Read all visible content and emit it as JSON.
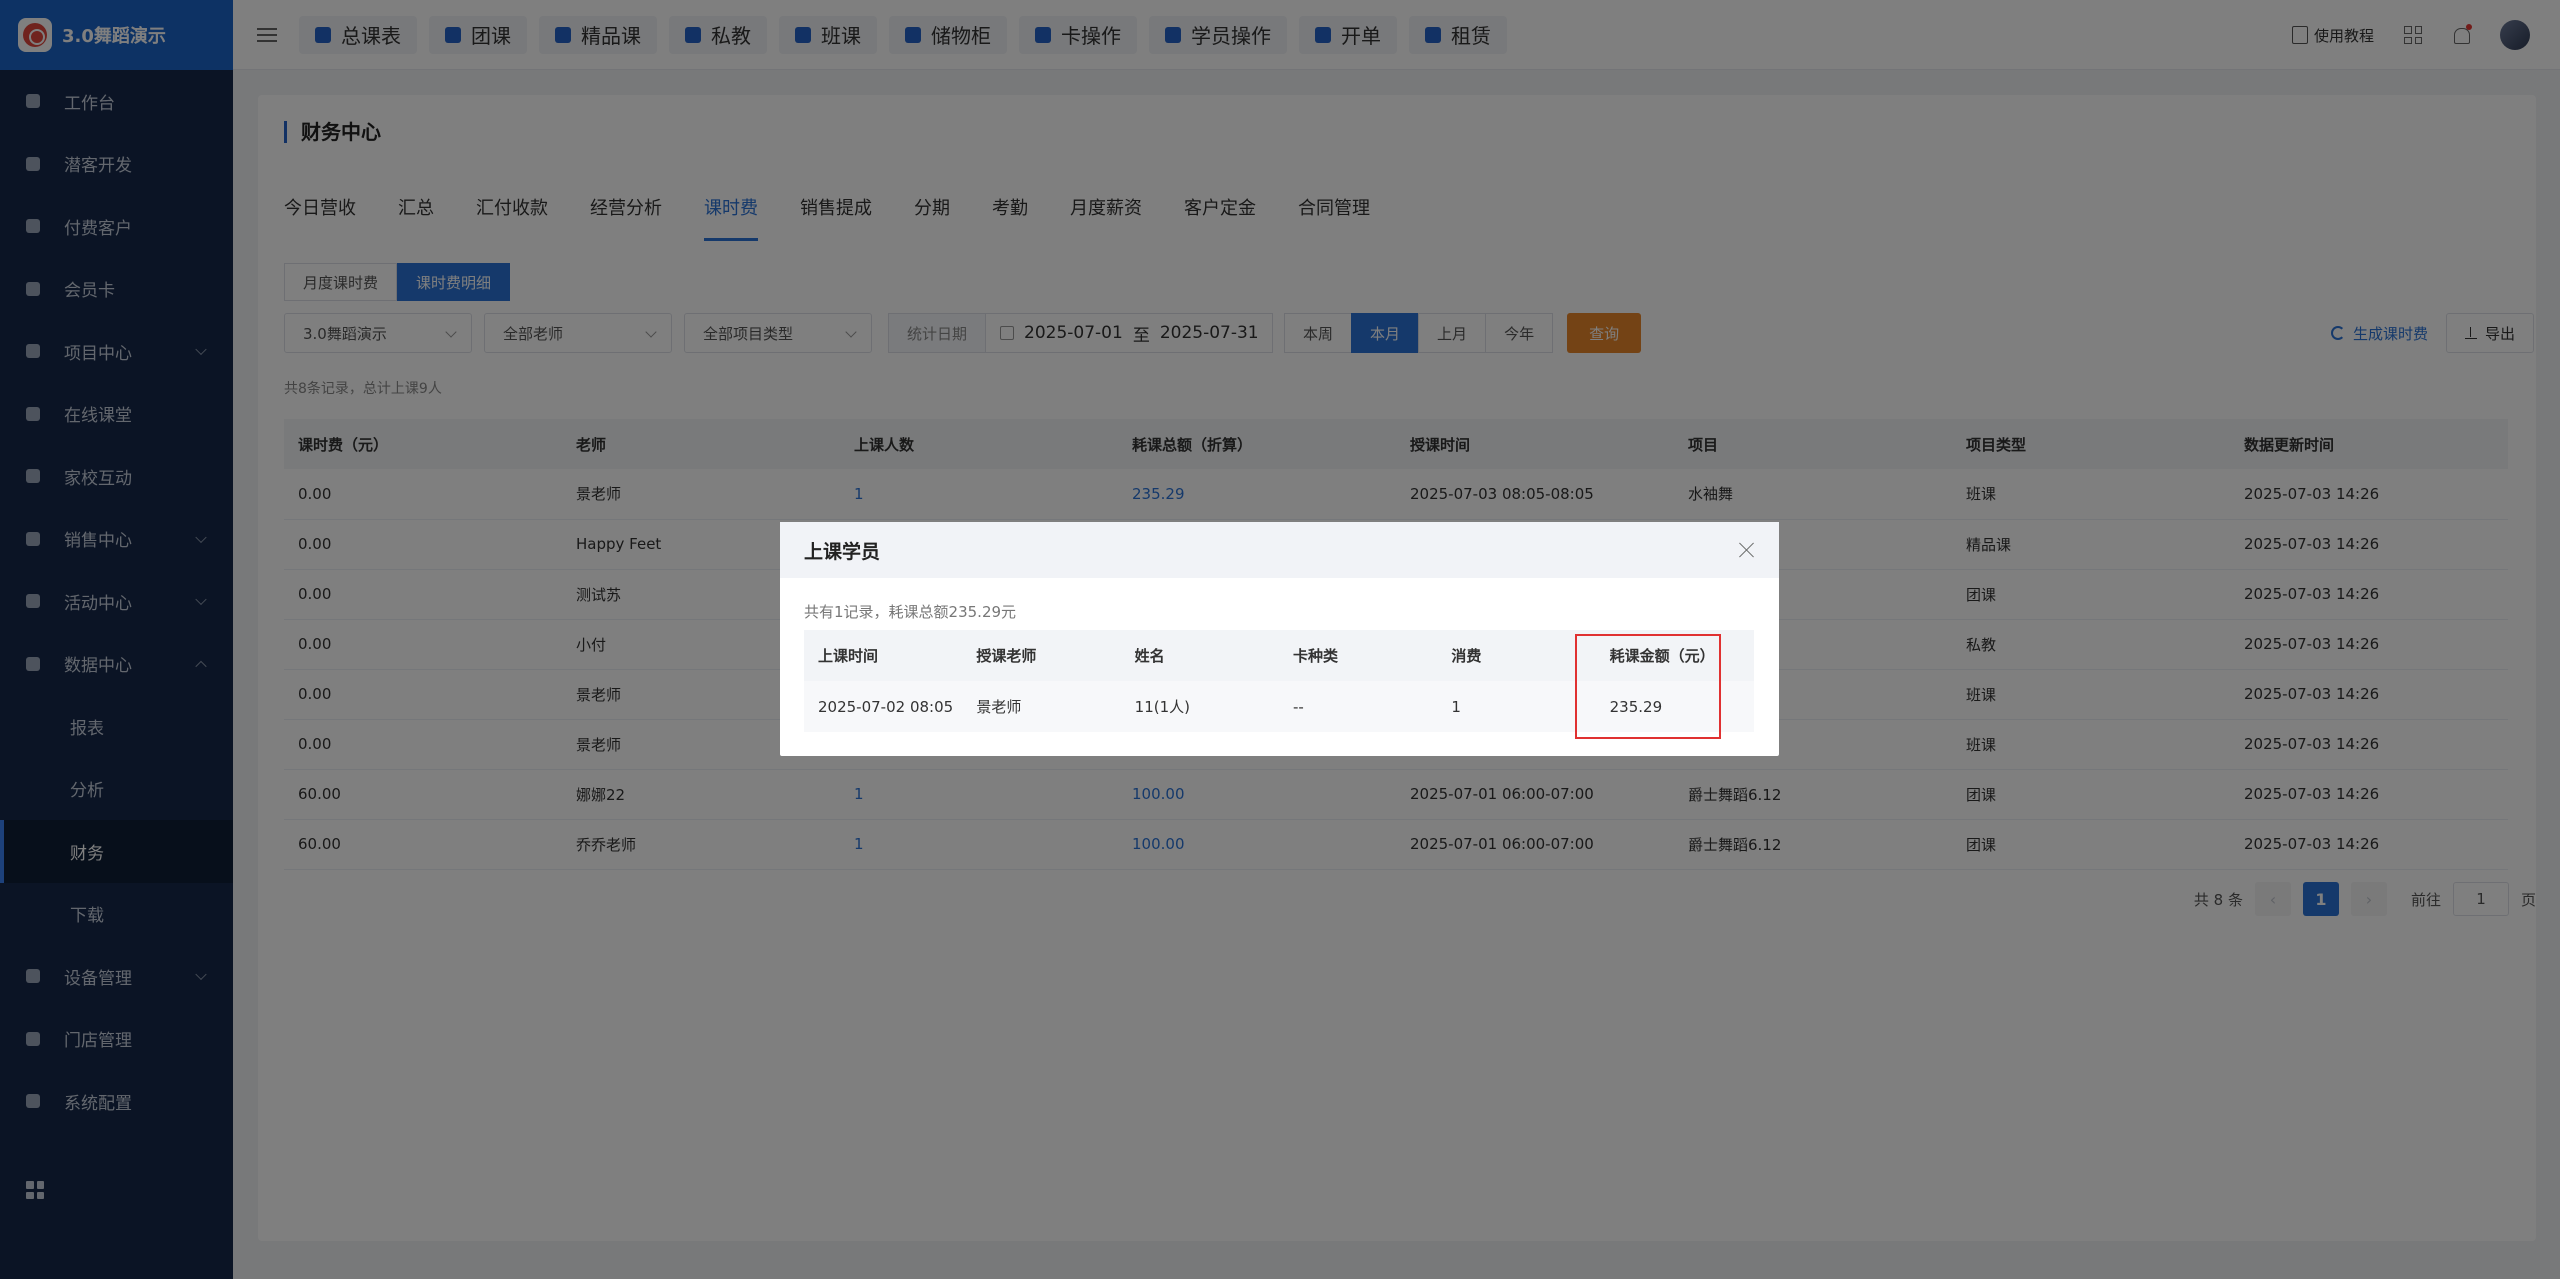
{
  "brand": {
    "name": "3.0舞蹈演示"
  },
  "sidebar": {
    "items": [
      {
        "label": "工作台",
        "icon": "image-icon"
      },
      {
        "label": "潜客开发",
        "icon": "id-card-icon"
      },
      {
        "label": "付费客户",
        "icon": "users-icon"
      },
      {
        "label": "会员卡",
        "icon": "card-icon"
      },
      {
        "label": "项目中心",
        "icon": "folder-icon",
        "expandable": true
      },
      {
        "label": "在线课堂",
        "icon": "bag-icon"
      },
      {
        "label": "家校互动",
        "icon": "contact-icon"
      },
      {
        "label": "销售中心",
        "icon": "tag-icon",
        "expandable": true
      },
      {
        "label": "活动中心",
        "icon": "gift-icon",
        "expandable": true
      },
      {
        "label": "数据中心",
        "icon": "pie-icon",
        "expanded": true
      }
    ],
    "sub_items": [
      {
        "label": "报表"
      },
      {
        "label": "分析"
      },
      {
        "label": "财务",
        "active": true
      },
      {
        "label": "下载"
      }
    ],
    "items_after": [
      {
        "label": "设备管理",
        "icon": "device-icon",
        "expandable": true
      },
      {
        "label": "门店管理",
        "icon": "store-icon"
      },
      {
        "label": "系统配置",
        "icon": "monitor-icon"
      }
    ]
  },
  "topbar": {
    "tabs": [
      {
        "label": "总课表"
      },
      {
        "label": "团课"
      },
      {
        "label": "精品课"
      },
      {
        "label": "私教"
      },
      {
        "label": "班课"
      },
      {
        "label": "储物柜"
      },
      {
        "label": "卡操作"
      },
      {
        "label": "学员操作"
      },
      {
        "label": "开单"
      },
      {
        "label": "租赁"
      }
    ],
    "help_label": "使用教程"
  },
  "page": {
    "title": "财务中心",
    "tabs": [
      {
        "label": "今日营收"
      },
      {
        "label": "汇总"
      },
      {
        "label": "汇付收款"
      },
      {
        "label": "经营分析"
      },
      {
        "label": "课时费",
        "active": true
      },
      {
        "label": "销售提成"
      },
      {
        "label": "分期"
      },
      {
        "label": "考勤"
      },
      {
        "label": "月度薪资"
      },
      {
        "label": "客户定金"
      },
      {
        "label": "合同管理"
      }
    ],
    "segments": [
      {
        "label": "月度课时费"
      },
      {
        "label": "课时费明细",
        "active": true
      }
    ],
    "filters": {
      "store": "3.0舞蹈演示",
      "teacher": "全部老师",
      "project_type": "全部项目类型",
      "date_label": "统计日期",
      "date_start": "2025-07-01",
      "date_sep": "至",
      "date_end": "2025-07-31",
      "quick": [
        {
          "label": "本周"
        },
        {
          "label": "本月",
          "active": true
        },
        {
          "label": "上月"
        },
        {
          "label": "今年"
        }
      ],
      "query_label": "查询",
      "generate_label": "生成课时费",
      "export_label": "导出"
    },
    "summary": "共8条记录，总计上课9人",
    "table": {
      "headers": [
        "课时费（元）",
        "老师",
        "上课人数",
        "耗课总额（折算）",
        "授课时间",
        "项目",
        "项目类型",
        "数据更新时间"
      ],
      "rows": [
        [
          "0.00",
          "景老师",
          "1",
          "235.29",
          "2025-07-03 08:05-08:05",
          "水袖舞",
          "班课",
          "2025-07-03 14:26"
        ],
        [
          "0.00",
          "Happy Feet",
          "",
          "",
          "",
          "",
          "精品课",
          "2025-07-03 14:26"
        ],
        [
          "0.00",
          "测试苏",
          "",
          "",
          "",
          "",
          "团课",
          "2025-07-03 14:26"
        ],
        [
          "0.00",
          "小付",
          "",
          "",
          "",
          "",
          "私教",
          "2025-07-03 14:26"
        ],
        [
          "0.00",
          "景老师",
          "",
          "",
          "",
          "",
          "班课",
          "2025-07-03 14:26"
        ],
        [
          "0.00",
          "景老师",
          "",
          "",
          "",
          "",
          "班课",
          "2025-07-03 14:26"
        ],
        [
          "60.00",
          "娜娜22",
          "1",
          "100.00",
          "2025-07-01 06:00-07:00",
          "爵士舞蹈6.12",
          "团课",
          "2025-07-03 14:26"
        ],
        [
          "60.00",
          "乔乔老师",
          "1",
          "100.00",
          "2025-07-01 06:00-07:00",
          "爵士舞蹈6.12",
          "团课",
          "2025-07-03 14:26"
        ]
      ]
    },
    "pager": {
      "total": "共 8 条",
      "current": "1",
      "goto_label": "前往",
      "goto_value": "1",
      "page_unit": "页"
    }
  },
  "modal": {
    "title": "上课学员",
    "summary": "共有1记录，耗课总额235.29元",
    "headers": [
      "上课时间",
      "授课老师",
      "姓名",
      "卡种类",
      "消费",
      "耗课金额（元）"
    ],
    "rows": [
      [
        "2025-07-02 08:05",
        "景老师",
        "11(1人)",
        "--",
        "1",
        "235.29"
      ]
    ]
  },
  "colors": {
    "primary": "#2b73d6",
    "sidebar": "#17294a",
    "brand_bar": "#1b64c8",
    "query_button": "#e8862a",
    "highlight": "#e03131"
  }
}
